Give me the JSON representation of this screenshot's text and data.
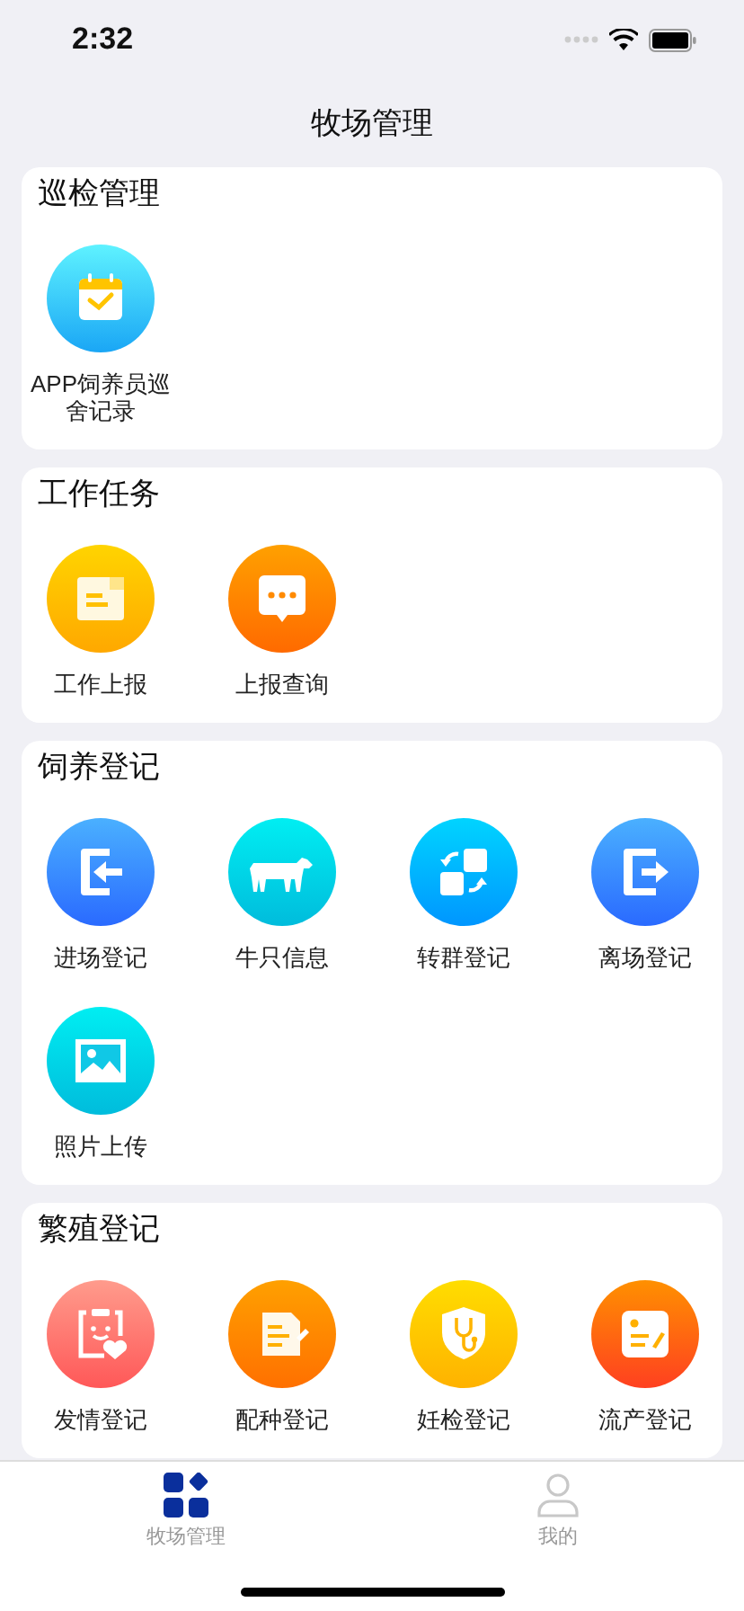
{
  "status_bar": {
    "time": "2:32"
  },
  "nav_bar": {
    "title": "牧场管理"
  },
  "sections": [
    {
      "title": "巡检管理",
      "items": [
        "APP饲养员巡舍记录"
      ]
    },
    {
      "title": "工作任务",
      "items": [
        "工作上报",
        "上报查询"
      ]
    },
    {
      "title": "饲养登记",
      "items": [
        "进场登记",
        "牛只信息",
        "转群登记",
        "离场登记",
        "照片上传"
      ]
    },
    {
      "title": "繁殖登记",
      "items": [
        "发情登记",
        "配种登记",
        "妊检登记",
        "流产登记"
      ]
    }
  ],
  "tab_bar": [
    {
      "label": "牧场管理",
      "selected": true
    },
    {
      "label": "我的",
      "selected": false
    }
  ]
}
